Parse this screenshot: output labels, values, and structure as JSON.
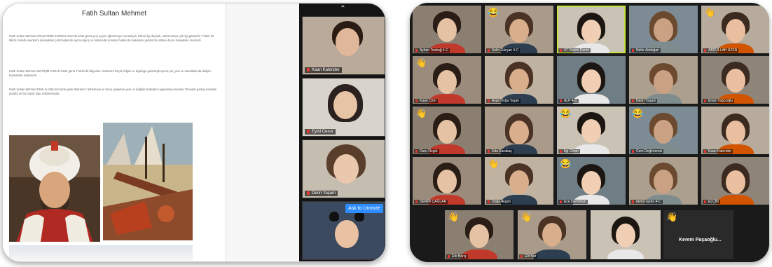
{
  "document": {
    "title": "Fatih Sultan Mehmet",
    "paragraphs": [
      "Fatih Sultan Mehmet ARAŞTIRMA SORGULAMA'da birde günü yeni şeyler öğrenmeye meraklıydı, bilime ilgi duyardı, astronomiye çok ilgi gösterdi, 7 farklı dil bilirdi, felsefe eserlerini okumaktan çok hoşlanırdı ayrıca ilginç ve bilinmedik konular hakkında makaleler yazdırırdı üstüne da bu makaleleri incelerdi.",
      "Fatih Sultan Mehmet İLETİŞİM KURAN birde günü 7 farklı dil biliyordu. İstanbul'u birçok bilgisi ve diyalogu gelimleşti ayrıca şiir, yazı ve sanatlarla da iletişim kurmaktan hoşlanırdı.",
      "Fatih Sultan Mehmet RİSK ALABİLEN birde günü İstanbul'u fethetmeyi ve bunu yaparken yeni ve değişik stratejiler uygulamayı mesela 70 kadar gemiyi karadan yürüttü ve bu büyük topu döktürmüştür."
    ]
  },
  "sidebar": {
    "collapse_icon": "chevron-up-icon",
    "participants": [
      {
        "name": "Kaan Kalender"
      },
      {
        "name": "Eylül Cesur"
      },
      {
        "name": "Derin Yaşam"
      },
      {
        "name": ""
      }
    ],
    "admit_label": "Ask to Unmute"
  },
  "gallery": {
    "rows": [
      [
        {
          "name": "Ayhan Tosbağ 4-C",
          "reaction": ""
        },
        {
          "name": "Selin Gürçan 4-C",
          "reaction": "😂"
        },
        {
          "name": "47 Özlem Demir",
          "reaction": "",
          "active": true
        },
        {
          "name": "Nehir Akdoğan",
          "reaction": ""
        },
        {
          "name": "ABDULLAH ÜZEN",
          "reaction": "👋"
        }
      ],
      [
        {
          "name": "Kaan Çöm",
          "reaction": "👋"
        },
        {
          "name": "Ayşe Doğa Taşan",
          "reaction": ""
        },
        {
          "name": "ALP 4-C",
          "reaction": ""
        },
        {
          "name": "Derin Yaşam",
          "reaction": ""
        },
        {
          "name": "Emre Yağcıoğlu",
          "reaction": ""
        }
      ],
      [
        {
          "name": "Duru Özgür",
          "reaction": "👋"
        },
        {
          "name": "Eda Karakaş",
          "reaction": ""
        },
        {
          "name": "İlgi Cihan",
          "reaction": "😂"
        },
        {
          "name": "Cem Değirmenci",
          "reaction": "😂"
        },
        {
          "name": "Kaan Kalender",
          "reaction": ""
        }
      ],
      [
        {
          "name": "DEMİR ÇAĞLAR",
          "reaction": ""
        },
        {
          "name": "Doğa Akgün",
          "reaction": "👋"
        },
        {
          "name": "Ece Demirhan",
          "reaction": "😂"
        },
        {
          "name": "demir aydın 4-C",
          "reaction": ""
        },
        {
          "name": "ELÇİN",
          "reaction": ""
        }
      ],
      [
        {
          "name": "Efe Barış",
          "reaction": "👋"
        },
        {
          "name": "Elif Nur",
          "reaction": "👋"
        },
        {
          "name": "",
          "reaction": ""
        },
        {
          "name": "Kerem Paşaoğlu...",
          "reaction": "👋",
          "speaker": true
        }
      ]
    ]
  },
  "colors": {
    "zoom_blue": "#2d8cff",
    "active_speaker": "#c6e33a",
    "muted_red": "#e53935"
  }
}
